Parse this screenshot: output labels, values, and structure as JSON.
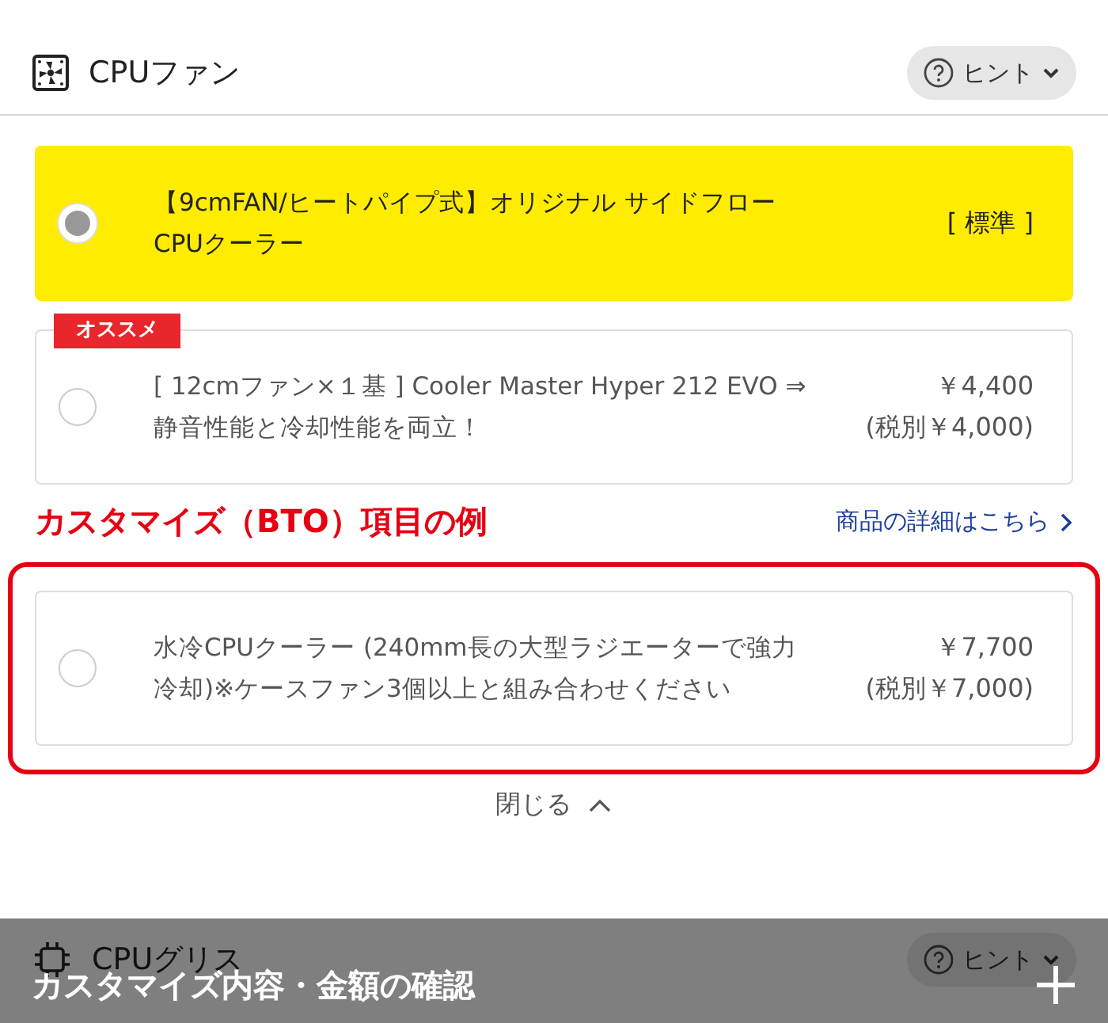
{
  "section": {
    "title": "CPUファン",
    "hint": "ヒント"
  },
  "options": [
    {
      "label": "【9cmFAN/ヒートパイプ式】オリジナル サイドフローCPUクーラー",
      "note": "[ 標準 ]",
      "selected": true,
      "highlighted": false
    },
    {
      "badge": "オススメ",
      "label": "[ 12cmファン×１基 ] Cooler Master Hyper 212 EVO ⇒ 静音性能と冷却性能を両立！",
      "price": "￥4,400",
      "price_ex_tax": "(税別￥4,000)",
      "selected": false,
      "highlighted": false
    },
    {
      "label": "水冷CPUクーラー (240mm長の大型ラジエーターで強力冷却)※ケースファン3個以上と組み合わせください",
      "price": "￥7,700",
      "price_ex_tax": "(税別￥7,000)",
      "selected": false,
      "highlighted": true
    }
  ],
  "annotation": "カスタマイズ（BTO）項目の例",
  "detail_link": "商品の詳細はこちら",
  "collapse": "閉じる",
  "next_section": {
    "title": "CPUグリス",
    "hint": "ヒント"
  },
  "footer": {
    "title": "カスタマイズ内容・金額の確認"
  }
}
